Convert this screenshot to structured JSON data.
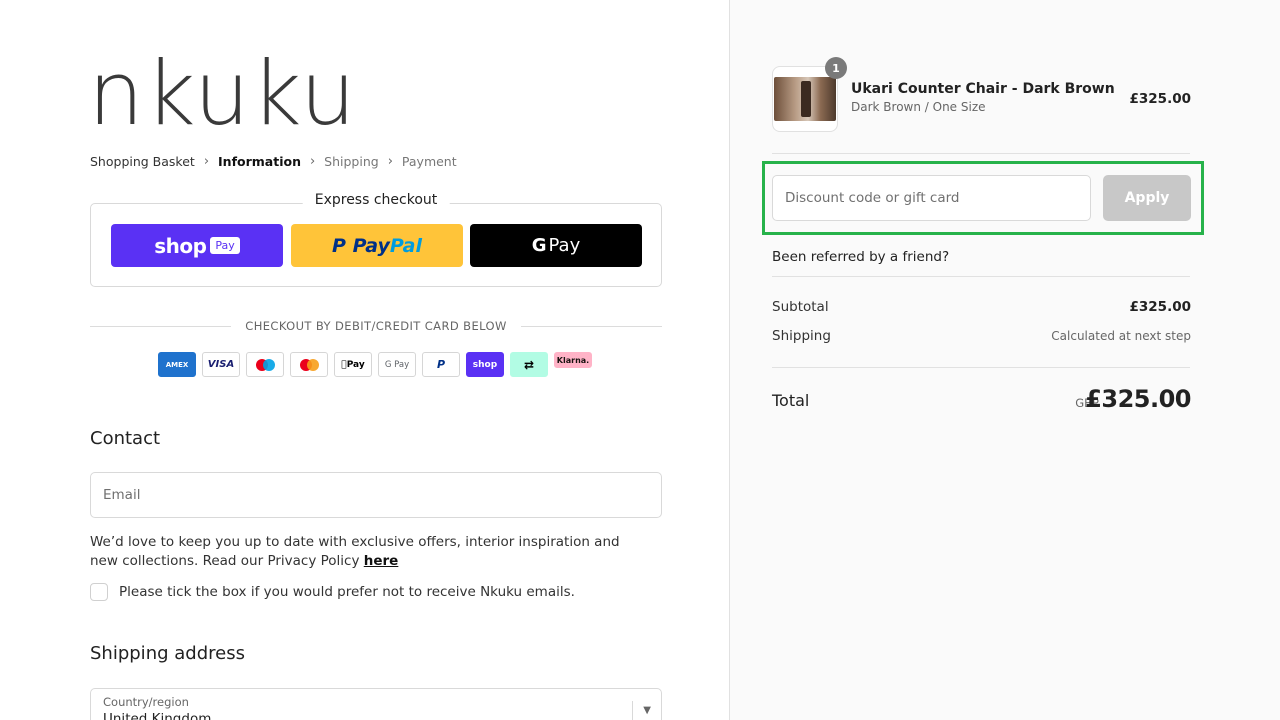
{
  "brand": {
    "logo_text": "nkuku"
  },
  "breadcrumb": {
    "items": [
      {
        "label": "Shopping Basket"
      },
      {
        "label": "Information"
      },
      {
        "label": "Shipping"
      },
      {
        "label": "Payment"
      }
    ],
    "separator": "›"
  },
  "express": {
    "title": "Express checkout",
    "shop_pay": {
      "word": "shop",
      "tag": "Pay"
    },
    "paypal": {
      "part1": "Pay",
      "part2": "Pal",
      "p_icon": "P"
    },
    "gpay": {
      "g": "G",
      "pay": "Pay"
    }
  },
  "card_section": {
    "label": "CHECKOUT BY DEBIT/CREDIT CARD BELOW",
    "cards": [
      {
        "name": "amex",
        "text": "AMEX"
      },
      {
        "name": "visa",
        "text": "VISA"
      },
      {
        "name": "maestro",
        "text": ""
      },
      {
        "name": "mastercard",
        "text": ""
      },
      {
        "name": "apple-pay",
        "text": "Pay"
      },
      {
        "name": "google-pay",
        "text": "G Pay"
      },
      {
        "name": "paypal",
        "text": "P"
      },
      {
        "name": "shop-pay",
        "text": "shop"
      },
      {
        "name": "clearpay",
        "text": "⇄"
      },
      {
        "name": "klarna",
        "text": "Klarna."
      }
    ]
  },
  "contact": {
    "heading": "Contact",
    "email_placeholder": "Email",
    "notice_text": "We’d love to keep you up to date with exclusive offers, interior inspiration and new collections. Read our Privacy Policy ",
    "notice_link": "here",
    "optout_label": "Please tick the box if you would prefer not to receive Nkuku emails."
  },
  "shipping_address": {
    "heading": "Shipping address",
    "country_label": "Country/region",
    "country_value": "United Kingdom"
  },
  "order": {
    "product": {
      "quantity": "1",
      "name": "Ukari Counter Chair - Dark Brown",
      "variant": "Dark Brown / One Size",
      "price": "£325.00"
    },
    "discount": {
      "placeholder": "Discount code or gift card",
      "apply_label": "Apply"
    },
    "referral": "Been referred by a friend?",
    "subtotal_label": "Subtotal",
    "subtotal_value": "£325.00",
    "shipping_label": "Shipping",
    "shipping_value": "Calculated at next step",
    "total_label": "Total",
    "currency": "GBP",
    "total_value": "£325.00"
  },
  "colors": {
    "shop_pay": "#5a31f4",
    "paypal": "#ffc439",
    "gpay": "#000000",
    "highlight": "#27b24a",
    "apply_disabled": "#c8c8c8"
  }
}
